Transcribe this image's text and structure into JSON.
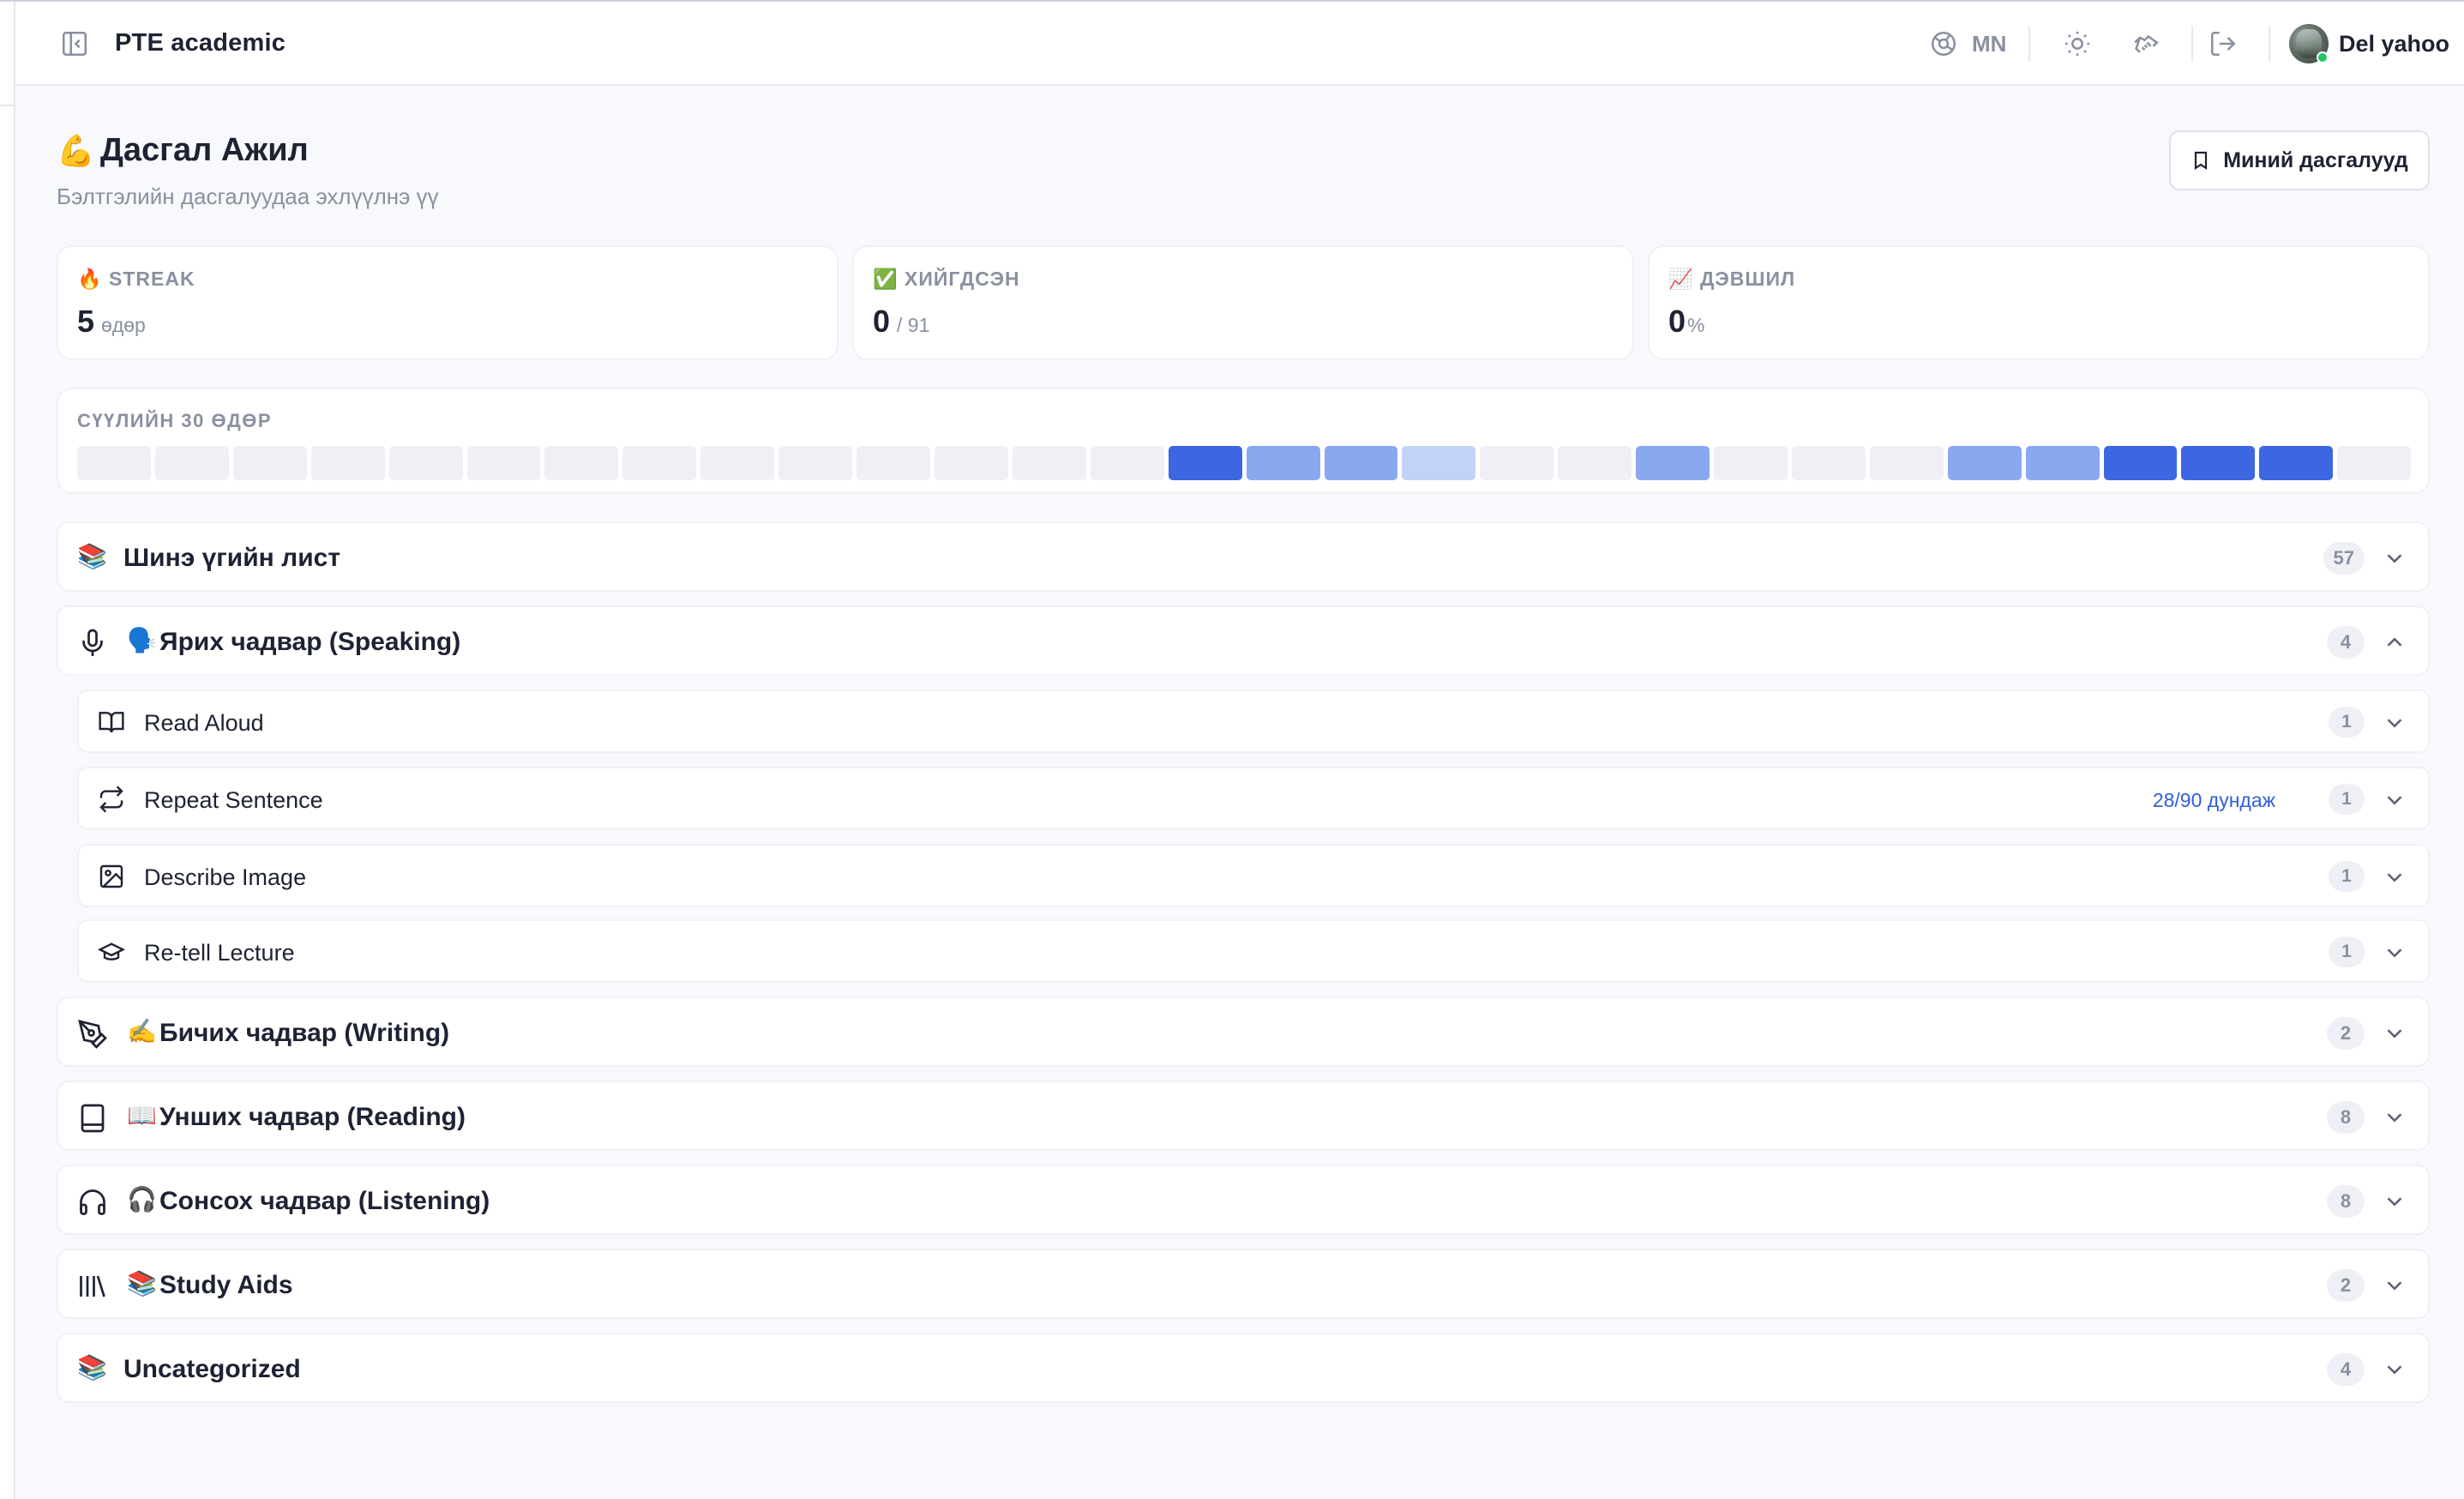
{
  "header": {
    "app_title": "PTE academic",
    "language": "MN",
    "user_name": "Del yahoo",
    "icons": [
      "sidebar-toggle-icon",
      "globe-icon",
      "sun-icon",
      "handshake-icon",
      "logout-icon"
    ]
  },
  "page": {
    "title_emoji": "💪",
    "title": "Дасгал Ажил",
    "subtitle": "Бэлтгэлийн дасгалуудаа эхлүүлнэ үү",
    "my_exercises_label": "Миний дасгалууд"
  },
  "stats": [
    {
      "emoji": "🔥",
      "label": "STREAK",
      "value": "5",
      "unit": "өдөр"
    },
    {
      "emoji": "✅",
      "label": "ХИЙГДСЭН",
      "value": "0",
      "unit": "/ 91"
    },
    {
      "emoji": "📈",
      "label": "ДЭВШИЛ",
      "value": "0",
      "unit": "%"
    }
  ],
  "activity": {
    "label": "СҮҮЛИЙН 30 ӨДӨР",
    "levels": [
      0,
      0,
      0,
      0,
      0,
      0,
      0,
      0,
      0,
      0,
      0,
      0,
      0,
      0,
      3,
      2,
      2,
      1,
      0,
      0,
      2,
      0,
      0,
      0,
      2,
      2,
      3,
      3,
      3,
      0
    ],
    "colors": {
      "0": "#eef0f5",
      "1": "#c2d3fa",
      "2": "#89a8f0",
      "3": "#3d67e0"
    }
  },
  "categories": [
    {
      "icon": "",
      "emoji": "📚",
      "title": "Шинэ үгийн лист",
      "count": "57",
      "expanded": false
    },
    {
      "icon": "microphone-icon",
      "emoji": "🗣️",
      "title": "Ярих чадвар (Speaking)",
      "count": "4",
      "expanded": true,
      "items": [
        {
          "icon": "book-open-icon",
          "title": "Read Aloud",
          "count": "1",
          "note": ""
        },
        {
          "icon": "repeat-icon",
          "title": "Repeat Sentence",
          "count": "1",
          "note": "28/90 дундаж"
        },
        {
          "icon": "image-icon",
          "title": "Describe Image",
          "count": "1",
          "note": ""
        },
        {
          "icon": "graduation-cap-icon",
          "title": "Re-tell Lecture",
          "count": "1",
          "note": ""
        }
      ]
    },
    {
      "icon": "pen-tool-icon",
      "emoji": "✍️",
      "title": "Бичих чадвар (Writing)",
      "count": "2",
      "expanded": false
    },
    {
      "icon": "book-icon",
      "emoji": "📖",
      "title": "Унших чадвар (Reading)",
      "count": "8",
      "expanded": false
    },
    {
      "icon": "headphones-icon",
      "emoji": "🎧",
      "title": "Сонсох чадвар (Listening)",
      "count": "8",
      "expanded": false
    },
    {
      "icon": "library-icon",
      "emoji": "📚",
      "title": "Study Aids",
      "count": "2",
      "expanded": false
    },
    {
      "icon": "",
      "emoji": "📚",
      "title": "Uncategorized",
      "count": "4",
      "expanded": false
    }
  ]
}
